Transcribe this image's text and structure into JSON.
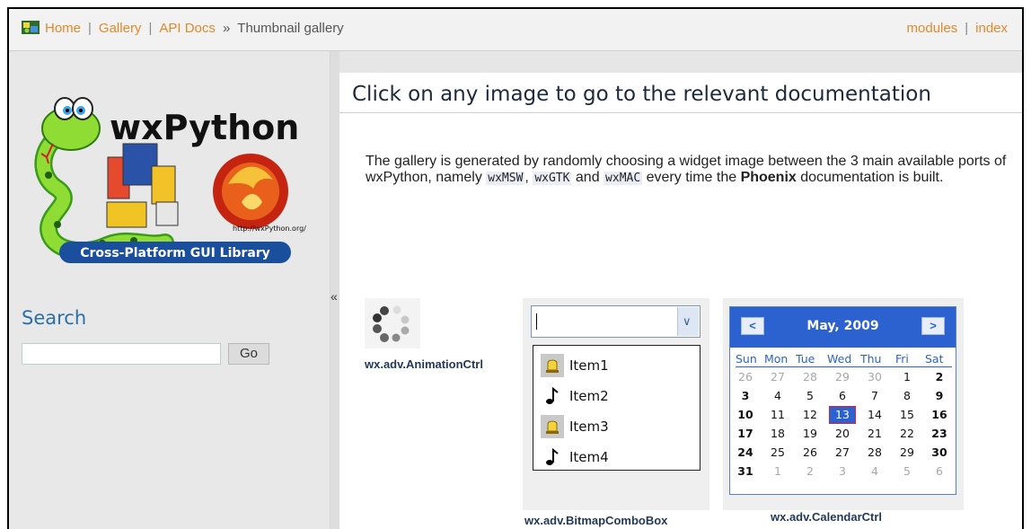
{
  "nav": {
    "home": "Home",
    "gallery": "Gallery",
    "api_docs": "API Docs",
    "raquo": "»",
    "current": "Thumbnail gallery",
    "sep": "|",
    "modules": "modules",
    "index": "index"
  },
  "sidebar": {
    "logo": {
      "wordmark": "wxPython",
      "url": "http://wxPython.org/",
      "banner": "Cross-Platform GUI Library"
    },
    "collapse": "«",
    "search_title": "Search",
    "search_value": "",
    "go_label": "Go"
  },
  "main": {
    "heading": "Click on any image to go to the relevant documentation",
    "intro": {
      "p1": "The gallery is generated by randomly choosing a widget image between the 3 main available ports of wxPython, namely ",
      "code1": "wxMSW",
      "p2": ", ",
      "code2": "wxGTK",
      "p3": " and ",
      "code3": "wxMAC",
      "p4": " every time the ",
      "strong": "Phoenix",
      "p5": " documentation is built."
    }
  },
  "gallery": {
    "animation_caption": "wx.adv.AnimationCtrl",
    "combo_caption": "wx.adv.BitmapComboBox",
    "calendar_caption": "wx.adv.CalendarCtrl",
    "combo_items": [
      {
        "label": "Item1",
        "icon": "bell-icon"
      },
      {
        "label": "Item2",
        "icon": "music-note-icon"
      },
      {
        "label": "Item3",
        "icon": "bell-icon"
      },
      {
        "label": "Item4",
        "icon": "music-note-icon"
      }
    ],
    "calendar": {
      "title": "May, 2009",
      "prev": "<",
      "next": ">",
      "weekdays": [
        "Sun",
        "Mon",
        "Tue",
        "Wed",
        "Thu",
        "Fri",
        "Sat"
      ],
      "weeks": [
        [
          "26",
          "27",
          "28",
          "29",
          "30",
          "1",
          "2"
        ],
        [
          "3",
          "4",
          "5",
          "6",
          "7",
          "8",
          "9"
        ],
        [
          "10",
          "11",
          "12",
          "13",
          "14",
          "15",
          "16"
        ],
        [
          "17",
          "18",
          "19",
          "20",
          "21",
          "22",
          "23"
        ],
        [
          "24",
          "25",
          "26",
          "27",
          "28",
          "29",
          "30"
        ],
        [
          "31",
          "1",
          "2",
          "3",
          "4",
          "5",
          "6"
        ]
      ],
      "selected": "13",
      "colors": {
        "header": "#2b62cf",
        "selection_border": "#dd2233"
      }
    }
  }
}
